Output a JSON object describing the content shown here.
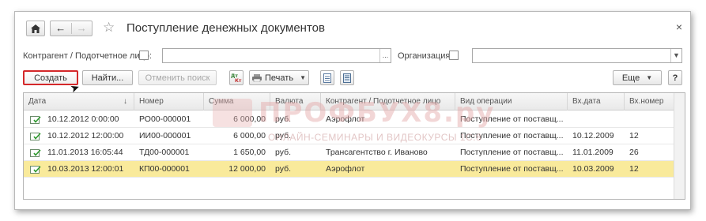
{
  "window": {
    "title": "Поступление денежных документов"
  },
  "filters": {
    "counterparty_label": "Контрагент / Подотчетное лицо:",
    "counterparty_value": "",
    "counterparty_more": "...",
    "organization_label": "Организация:",
    "organization_value": ""
  },
  "toolbar": {
    "create_label": "Создать",
    "find_label": "Найти...",
    "cancel_search_label": "Отменить поиск",
    "print_label": "Печать",
    "more_label": "Еще",
    "help_label": "?"
  },
  "watermark": {
    "main": "ПРОФБУХ8.ру",
    "sub": "ОНЛАЙН-СЕМИНАРЫ И ВИДЕОКУРСЫ 1С:8"
  },
  "table": {
    "columns": [
      "Дата",
      "Номер",
      "Сумма",
      "Валюта",
      "Контрагент / Подотчетное лицо",
      "Вид операции",
      "Вх.дата",
      "Вх.номер"
    ],
    "sort_indicator": "↓",
    "rows": [
      {
        "date": "10.12.2012 0:00:00",
        "number": "РО00-000001",
        "sum": "6 000,00",
        "currency": "руб.",
        "counterparty": "Аэрофлот",
        "operation": "Поступление от поставщ...",
        "in_date": "",
        "in_number": ""
      },
      {
        "date": "10.12.2012 12:00:00",
        "number": "ИИ00-000001",
        "sum": "6 000,00",
        "currency": "руб.",
        "counterparty": "",
        "operation": "Поступление от поставщ...",
        "in_date": "10.12.2009",
        "in_number": "12"
      },
      {
        "date": "11.01.2013 16:05:44",
        "number": "ТД00-000001",
        "sum": "1 650,00",
        "currency": "руб.",
        "counterparty": "Трансагентство г. Иваново",
        "operation": "Поступление от поставщ...",
        "in_date": "11.01.2009",
        "in_number": "26"
      },
      {
        "date": "10.03.2013 12:00:01",
        "number": "КП00-000001",
        "sum": "12 000,00",
        "currency": "руб.",
        "counterparty": "Аэрофлот",
        "operation": "Поступление от поставщ...",
        "in_date": "10.03.2009",
        "in_number": "12"
      }
    ]
  },
  "colors": {
    "selected_row": "#f9ea9b",
    "highlight_border": "#d4282a",
    "watermark": "#e4a6a6"
  }
}
